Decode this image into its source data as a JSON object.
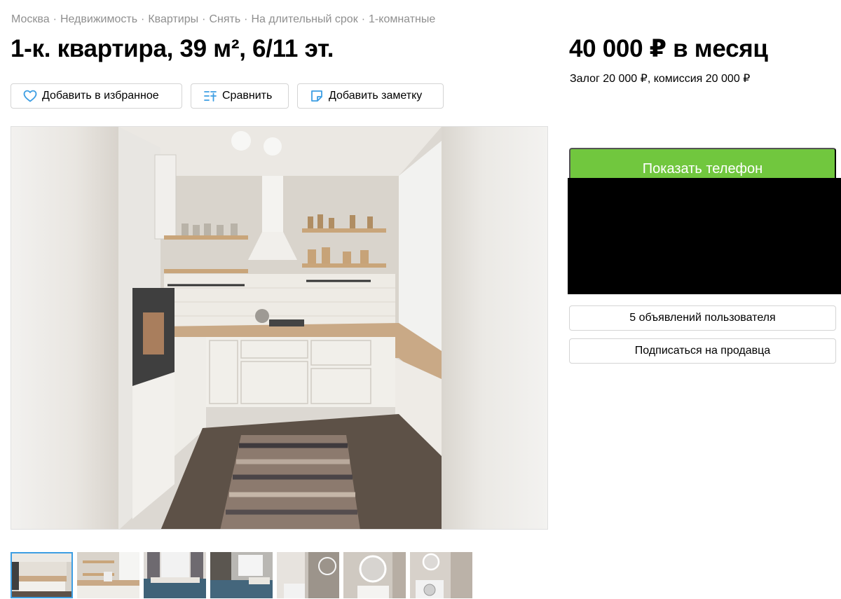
{
  "breadcrumbs": [
    "Москва",
    "Недвижимость",
    "Квартиры",
    "Снять",
    "На длительный срок",
    "1-комнатные"
  ],
  "breadcrumb_separator": "·",
  "listing": {
    "title": "1-к. квартира, 39 м², 6/11 эт.",
    "price": "40 000 ₽ в месяц",
    "deposit": "Залог 20 000 ₽, комиссия 20 000 ₽"
  },
  "actions": {
    "favorite_label": "Добавить в избранное",
    "compare_label": "Сравнить",
    "note_label": "Добавить заметку"
  },
  "seller": {
    "show_phone_label": "Показать телефон",
    "listings_label": "5 объявлений пользователя",
    "subscribe_label": "Подписаться на продавца"
  },
  "gallery": {
    "main_photo": "kitchen",
    "thumbnails": [
      "kitchen",
      "kitchen-2",
      "bedroom",
      "bedroom-2",
      "bathroom",
      "bathroom-mirror",
      "bathroom-washer"
    ],
    "active_index": 0
  },
  "icons": {
    "favorite": "heart-icon",
    "compare": "compare-list-icon",
    "note": "note-icon"
  },
  "colors": {
    "accent_green": "#71c73e",
    "icon_blue": "#3d9ee3",
    "muted_text": "#8f8f8f",
    "border": "#d4d4d4"
  }
}
